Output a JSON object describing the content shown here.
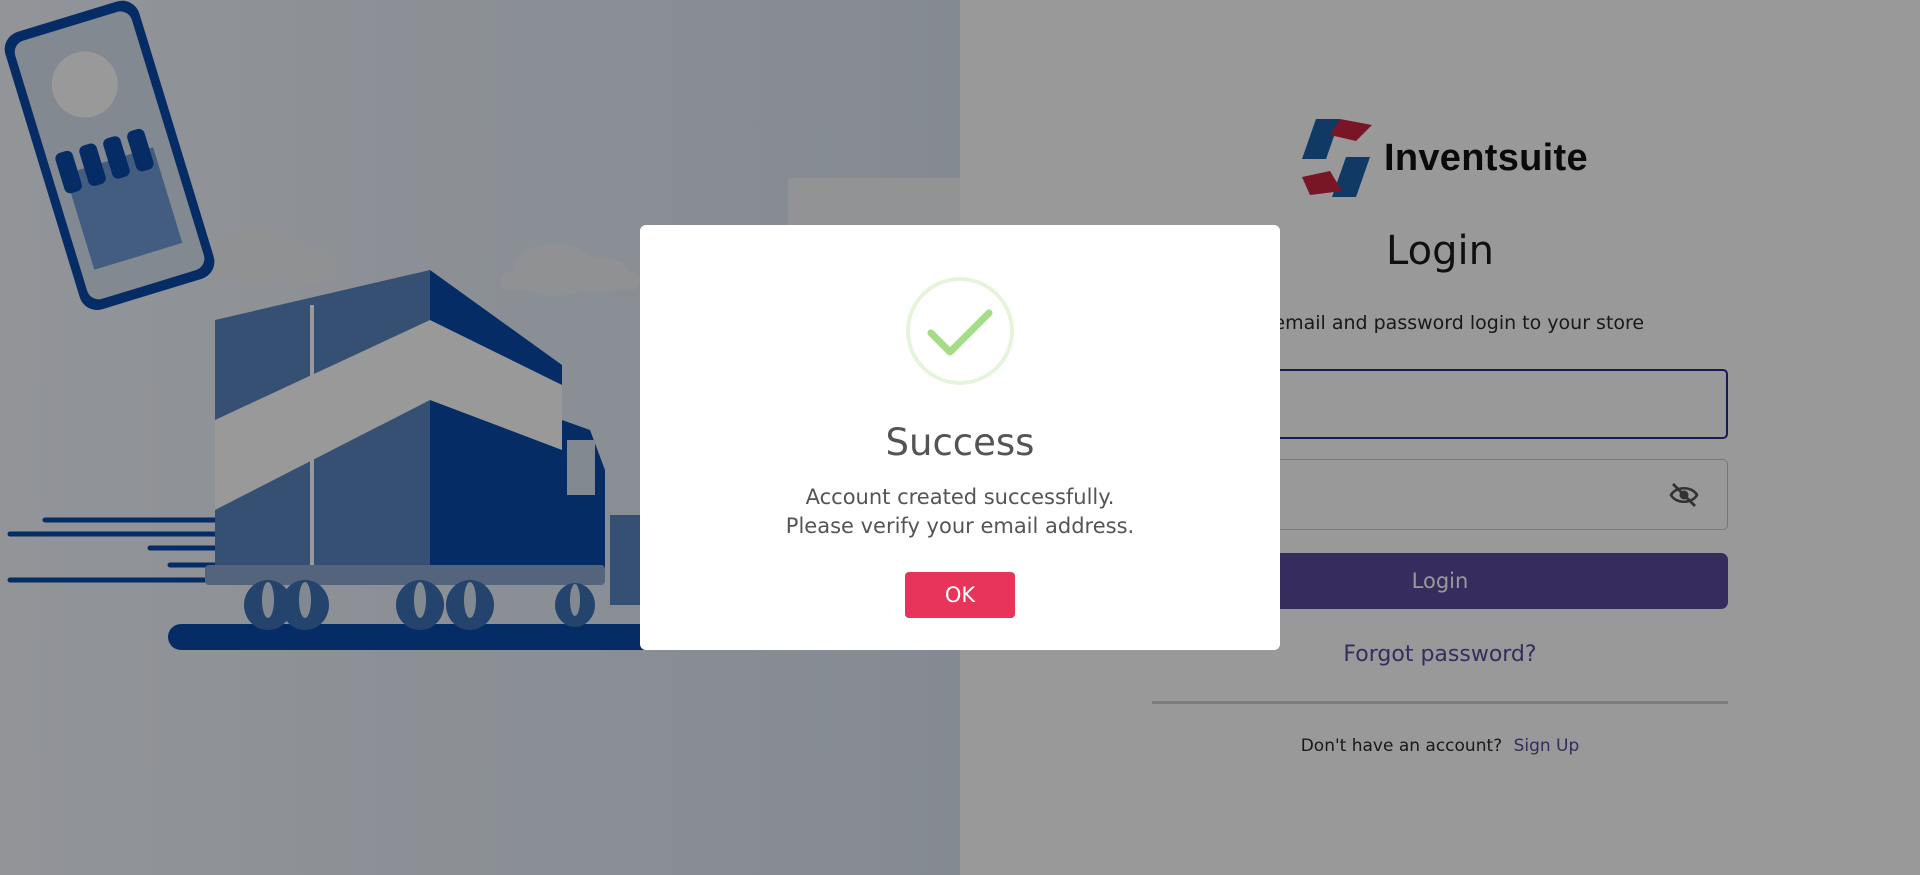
{
  "brand": {
    "name": "Inventsuite"
  },
  "login": {
    "title": "Login",
    "subtitle": "our email and password login to your store",
    "email_value": "",
    "password_value": "",
    "button_label": "Login",
    "forgot_label": "Forgot password?",
    "signup_prompt": "Don't have an account?",
    "signup_link": "Sign Up"
  },
  "modal": {
    "title": "Success",
    "line1": "Account created successfully.",
    "line2": "Please verify your email address.",
    "ok_label": "OK",
    "icon": "checkmark-icon"
  },
  "colors": {
    "accent_purple": "#5a4a9c",
    "ok_red": "#e8345a",
    "success_green": "#a5dc86",
    "logo_red": "#c8263f",
    "logo_blue": "#1d5fa8",
    "truck_blue": "#0a4aa8"
  },
  "icons": {
    "password_toggle": "eye-off-icon",
    "logo": "inventsuite-logo-icon"
  }
}
